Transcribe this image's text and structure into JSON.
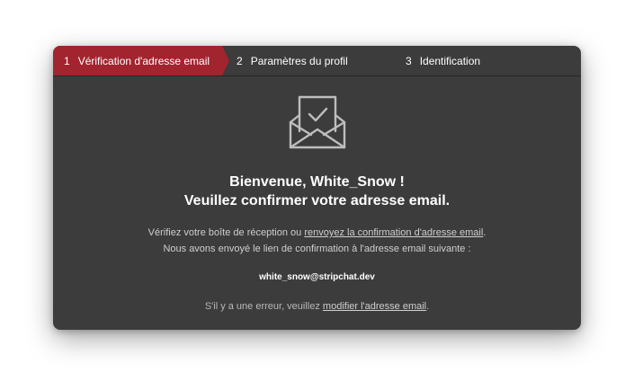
{
  "steps": [
    {
      "number": "1",
      "label": "Vérification d'adresse email",
      "active": true
    },
    {
      "number": "2",
      "label": "Paramètres du profil",
      "active": false
    },
    {
      "number": "3",
      "label": "Identification",
      "active": false
    }
  ],
  "colors": {
    "active_step": "#a2242f",
    "panel_background": "#3c3c3c",
    "text_primary": "#ffffff",
    "text_secondary": "#cfcfcf"
  },
  "icon": "envelope-check-icon",
  "greeting": {
    "line1": "Bienvenue, White_Snow !",
    "line2": "Veuillez confirmer votre adresse email."
  },
  "info": {
    "line1_prefix": "Vérifiez votre boîte de réception ou ",
    "resend_link": "renvoyez la confirmation d'adresse email",
    "line1_suffix": ".",
    "line2": "Nous avons envoyé le lien de confirmation à l'adresse email suivante :"
  },
  "email": "white_snow@stripchat.dev",
  "notice": {
    "prefix": "S'il y a une erreur, veuillez ",
    "modify_link": "modifier l'adresse email",
    "suffix": "."
  }
}
